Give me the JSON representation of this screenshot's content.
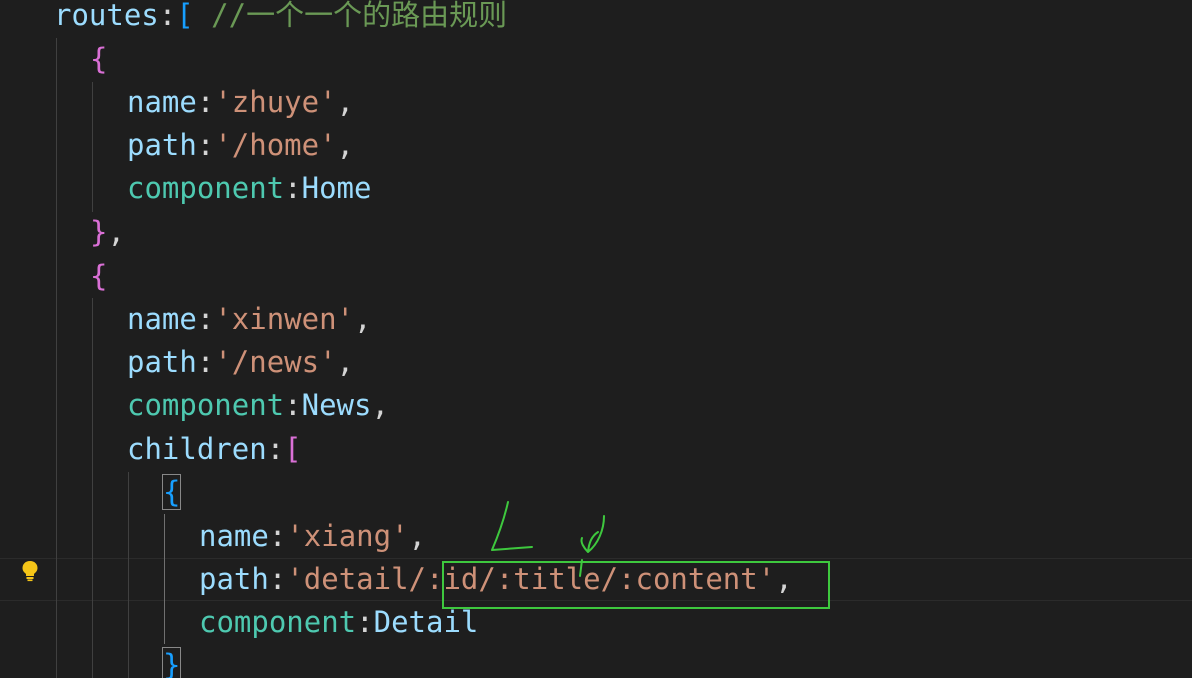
{
  "code": {
    "l1": {
      "key": "routes",
      "colon": ":",
      "bracket": "[",
      "comment": " //一个一个的路由规则"
    },
    "l2": {
      "brace": "{"
    },
    "l3": {
      "key": "name",
      "colon": ":",
      "value": "'zhuye'",
      "tail": ","
    },
    "l4": {
      "key": "path",
      "colon": ":",
      "value": "'/home'",
      "tail": ","
    },
    "l5": {
      "key": "component",
      "colon": ":",
      "value": "Home"
    },
    "l6": {
      "brace": "}",
      "tail": ","
    },
    "l7": {
      "brace": "{"
    },
    "l8": {
      "key": "name",
      "colon": ":",
      "value": "'xinwen'",
      "tail": ","
    },
    "l9": {
      "key": "path",
      "colon": ":",
      "value": "'/news'",
      "tail": ","
    },
    "l10": {
      "key": "component",
      "colon": ":",
      "value": "News",
      "tail": ","
    },
    "l11": {
      "key": "children",
      "colon": ":",
      "bracket": "["
    },
    "l12": {
      "brace": "{"
    },
    "l13": {
      "key": "name",
      "colon": ":",
      "value": "'xiang'",
      "tail": ","
    },
    "l14": {
      "key": "path",
      "colon": ":",
      "value_a": "'detail/",
      "value_b": ":id/:title/:content'",
      "tail": ","
    },
    "l15": {
      "key": "component",
      "colon": ":",
      "value": "Detail"
    },
    "l16": {
      "brace": "}"
    }
  },
  "colors": {
    "background": "#1e1e1e",
    "annotation": "#3ec83e",
    "lightbulb": "#f5c518"
  },
  "icons": {
    "gutter": "lightbulb-icon"
  }
}
